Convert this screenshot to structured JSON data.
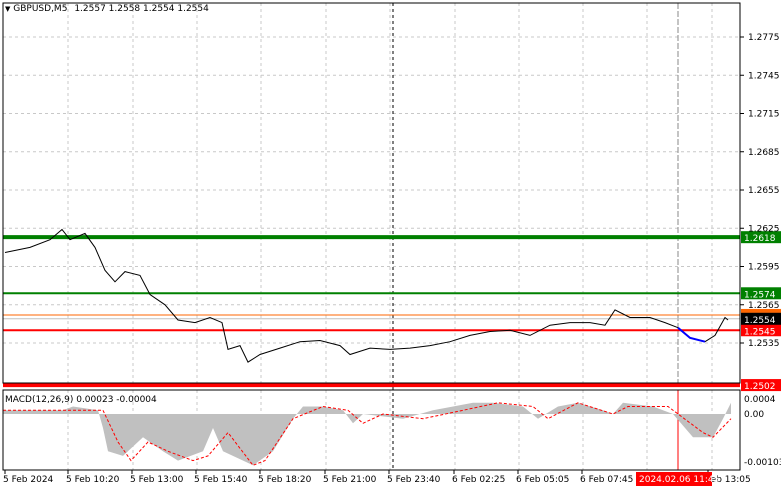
{
  "header": {
    "symbol": "GBPUSD,M5",
    "ohlc": "1.2557 1.2558 1.2554 1.2554"
  },
  "colors": {
    "support_green": "#008000",
    "resistance_red": "#ff0000",
    "current_price": "#000000",
    "orange_line": "#ff6600",
    "histogram": "#c0c0c0",
    "signal": "#ff0000",
    "highlight_segment": "#0000ff"
  },
  "chart_data": [
    {
      "type": "line",
      "title": "GBPUSD,M5",
      "y_ticks": [
        "1.2775",
        "1.2745",
        "1.2715",
        "1.2685",
        "1.2655",
        "1.2625",
        "1.2595",
        "1.2565",
        "1.2535"
      ],
      "ylim": [
        1.25,
        1.28
      ],
      "grid": true,
      "levels": [
        {
          "value": 1.2618,
          "label": "1.2618",
          "color": "#008000",
          "thick": true
        },
        {
          "value": 1.2574,
          "label": "1.2574",
          "color": "#008000",
          "thick": false
        },
        {
          "value": 1.2545,
          "label": "1.2545",
          "color": "#ff0000",
          "thick": false
        },
        {
          "value": 1.2502,
          "label": "1.2502",
          "color": "#ff0000",
          "thick": true
        }
      ],
      "current_price": {
        "value": 1.2554,
        "label": "1.2554"
      },
      "orange_level": 1.2557,
      "price_series": [
        [
          5,
          1.2606
        ],
        [
          30,
          1.261
        ],
        [
          50,
          1.2616
        ],
        [
          62,
          1.2624
        ],
        [
          70,
          1.2616
        ],
        [
          85,
          1.2621
        ],
        [
          95,
          1.261
        ],
        [
          105,
          1.2592
        ],
        [
          115,
          1.2583
        ],
        [
          125,
          1.2591
        ],
        [
          140,
          1.2588
        ],
        [
          150,
          1.2573
        ],
        [
          165,
          1.2565
        ],
        [
          178,
          1.2553
        ],
        [
          195,
          1.2551
        ],
        [
          210,
          1.2555
        ],
        [
          222,
          1.2551
        ],
        [
          228,
          1.253
        ],
        [
          240,
          1.2533
        ],
        [
          248,
          1.252
        ],
        [
          260,
          1.2526
        ],
        [
          280,
          1.2531
        ],
        [
          300,
          1.2536
        ],
        [
          320,
          1.2537
        ],
        [
          340,
          1.2533
        ],
        [
          350,
          1.2526
        ],
        [
          370,
          1.2531
        ],
        [
          390,
          1.253
        ],
        [
          410,
          1.2531
        ],
        [
          430,
          1.2533
        ],
        [
          450,
          1.2536
        ],
        [
          470,
          1.2541
        ],
        [
          490,
          1.2544
        ],
        [
          510,
          1.2545
        ],
        [
          530,
          1.2541
        ],
        [
          550,
          1.2549
        ],
        [
          570,
          1.2551
        ],
        [
          590,
          1.2551
        ],
        [
          605,
          1.2549
        ],
        [
          615,
          1.2561
        ],
        [
          630,
          1.2555
        ],
        [
          650,
          1.2555
        ],
        [
          665,
          1.2551
        ],
        [
          678,
          1.2547
        ]
      ],
      "highlight_series": [
        [
          678,
          1.2547
        ],
        [
          690,
          1.2539
        ],
        [
          705,
          1.2536
        ]
      ],
      "tail_series": [
        [
          705,
          1.2536
        ],
        [
          715,
          1.2541
        ],
        [
          725,
          1.2555
        ],
        [
          728,
          1.2553
        ]
      ]
    },
    {
      "type": "bar",
      "title": "MACD(12,26,9) 0.00023 -0.00004",
      "y_ticks": [
        "0.0004",
        "0.00",
        "-0.00103"
      ],
      "ylim": [
        -0.00115,
        0.00045
      ],
      "histogram": [
        [
          0,
          0.0001
        ],
        [
          60,
          0.0001
        ],
        [
          70,
          0.0002
        ],
        [
          95,
          0.0001
        ],
        [
          100,
          -0.0003
        ],
        [
          105,
          -0.0008
        ],
        [
          120,
          -0.0009
        ],
        [
          140,
          -0.0005
        ],
        [
          160,
          -0.0008
        ],
        [
          175,
          -0.001
        ],
        [
          200,
          -0.0008
        ],
        [
          210,
          -0.0003
        ],
        [
          220,
          -0.0008
        ],
        [
          250,
          -0.0011
        ],
        [
          270,
          -0.0008
        ],
        [
          290,
          -0.0001
        ],
        [
          300,
          0.0002
        ],
        [
          320,
          0.0002
        ],
        [
          340,
          0.0001
        ],
        [
          350,
          -0.0002
        ],
        [
          360,
          0.0
        ],
        [
          400,
          -0.0001
        ],
        [
          430,
          0.0001
        ],
        [
          470,
          0.0003
        ],
        [
          490,
          0.0003
        ],
        [
          520,
          0.0002
        ],
        [
          535,
          -0.0001
        ],
        [
          555,
          0.0002
        ],
        [
          575,
          0.0003
        ],
        [
          600,
          0.0001
        ],
        [
          610,
          0.0
        ],
        [
          620,
          0.0003
        ],
        [
          650,
          0.0002
        ],
        [
          670,
          0.0
        ],
        [
          690,
          -0.0005
        ],
        [
          710,
          -0.0005
        ],
        [
          720,
          -0.0001
        ],
        [
          728,
          0.0003
        ]
      ],
      "signal": [
        [
          0,
          0.0001
        ],
        [
          70,
          0.0001
        ],
        [
          100,
          0.0001
        ],
        [
          115,
          -0.0006
        ],
        [
          128,
          -0.001
        ],
        [
          145,
          -0.0006
        ],
        [
          165,
          -0.0008
        ],
        [
          190,
          -0.001
        ],
        [
          205,
          -0.0009
        ],
        [
          225,
          -0.0004
        ],
        [
          250,
          -0.0011
        ],
        [
          262,
          -0.001
        ],
        [
          290,
          -0.0001
        ],
        [
          320,
          0.0002
        ],
        [
          345,
          0.0001
        ],
        [
          360,
          -0.0002
        ],
        [
          380,
          0.0
        ],
        [
          420,
          -0.0001
        ],
        [
          460,
          0.0001
        ],
        [
          495,
          0.0003
        ],
        [
          530,
          0.0002
        ],
        [
          545,
          -0.0001
        ],
        [
          575,
          0.0003
        ],
        [
          610,
          0.0
        ],
        [
          625,
          0.0002
        ],
        [
          665,
          0.0002
        ],
        [
          700,
          -0.0004
        ],
        [
          710,
          -0.0005
        ],
        [
          728,
          -0.0001
        ]
      ]
    }
  ],
  "time_axis": [
    "5 Feb 2024",
    "5 Feb 10:20",
    "5 Feb 13:00",
    "5 Feb 15:40",
    "5 Feb 18:20",
    "5 Feb 21:00",
    "5 Feb 23:40",
    "6 Feb 02:25",
    "6 Feb 05:05",
    "6 Feb 07:45",
    "Feb 13:05"
  ],
  "crosshair_time": "2024.02.06 11:45"
}
